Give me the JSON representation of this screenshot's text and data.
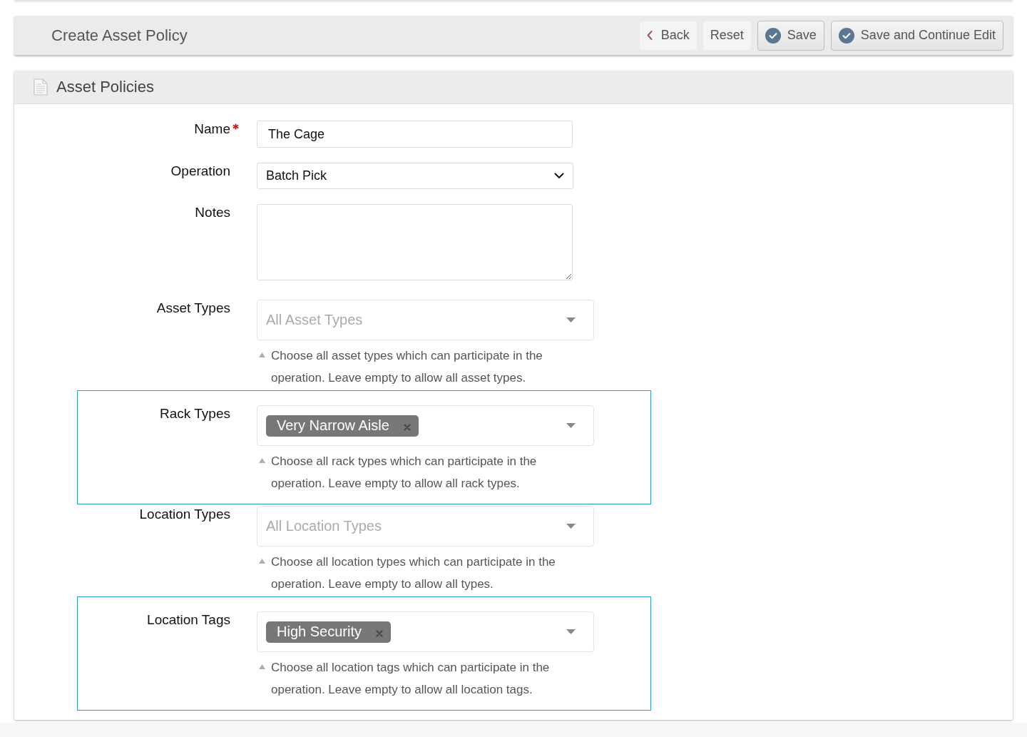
{
  "top_bar": {
    "title": "Create Asset Policy",
    "buttons": [
      {
        "kind": "back",
        "label": "Back"
      },
      {
        "kind": "plain",
        "label": "Reset"
      },
      {
        "kind": "confirm",
        "label": "Save"
      },
      {
        "kind": "confirm",
        "label": "Save and Continue Edit"
      }
    ]
  },
  "panel": {
    "title": "Asset Policies",
    "fields": [
      {
        "kind": "text",
        "label": "Name",
        "required": true,
        "value": "The Cage",
        "highlighted": false
      },
      {
        "kind": "select",
        "label": "Operation",
        "required": false,
        "value": "Batch Pick",
        "highlighted": false
      },
      {
        "kind": "textarea",
        "label": "Notes",
        "required": false,
        "highlighted": false
      },
      {
        "kind": "multiselect",
        "label": "Asset Types",
        "required": false,
        "placeholder": "All Asset Types",
        "help": "Choose all asset types which can participate in the operation. Leave empty to allow all asset types.",
        "highlighted": false
      },
      {
        "kind": "multiselect",
        "label": "Rack Types",
        "required": false,
        "tags": [
          "Very Narrow Aisle"
        ],
        "help": "Choose all rack types which can participate in the operation. Leave empty to allow all rack types.",
        "highlighted": true
      },
      {
        "kind": "multiselect",
        "label": "Location Types",
        "required": false,
        "placeholder": "All Location Types",
        "help": "Choose all location types which can participate in the operation. Leave empty to allow all types.",
        "highlighted": false
      },
      {
        "kind": "multiselect",
        "label": "Location Tags",
        "required": false,
        "tags": [
          "High Security"
        ],
        "help": "Choose all location tags which can participate in the operation. Leave empty to allow all location tags.",
        "highlighted": true
      }
    ]
  }
}
